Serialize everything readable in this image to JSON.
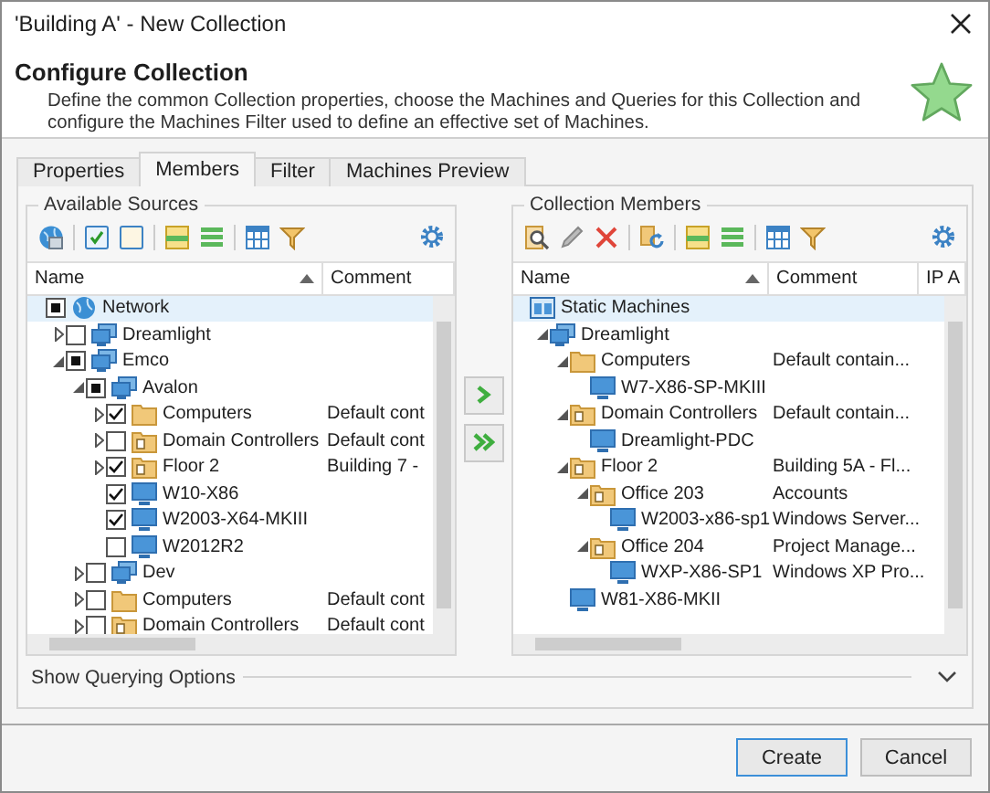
{
  "window": {
    "title": "'Building A' - New Collection"
  },
  "header": {
    "title": "Configure Collection",
    "description": "Define the common Collection properties, choose the Machines and Queries for this Collection and configure the Machines Filter used to define an effective set of Machines."
  },
  "tabs": [
    {
      "label": "Properties",
      "selected": false
    },
    {
      "label": "Members",
      "selected": true
    },
    {
      "label": "Filter",
      "selected": false
    },
    {
      "label": "Machines Preview",
      "selected": false
    }
  ],
  "sources": {
    "title": "Available Sources",
    "columns": [
      "Name",
      "Comment"
    ],
    "tree": [
      {
        "name": "Network",
        "kind": "network",
        "checked": true,
        "partial": true,
        "selected": true,
        "children": [
          {
            "name": "Dreamlight",
            "kind": "group",
            "checked": false,
            "partial": false,
            "expanded": false,
            "selected": false
          },
          {
            "name": "Emco",
            "kind": "group",
            "checked": true,
            "partial": true,
            "expanded": true,
            "selected": false,
            "children": [
              {
                "name": "Avalon",
                "kind": "group",
                "checked": true,
                "partial": true,
                "expanded": true,
                "selected": false,
                "children": [
                  {
                    "name": "Computers",
                    "kind": "folder",
                    "checked": true,
                    "partial": false,
                    "expanded": false,
                    "selected": false,
                    "comment": "Default cont"
                  },
                  {
                    "name": "Domain Controllers",
                    "kind": "ou",
                    "checked": false,
                    "partial": false,
                    "expanded": false,
                    "selected": false,
                    "comment": "Default cont"
                  },
                  {
                    "name": "Floor 2",
                    "kind": "ou",
                    "checked": true,
                    "partial": false,
                    "expanded": false,
                    "selected": false,
                    "comment": "Building 7 -"
                  },
                  {
                    "name": "W10-X86",
                    "kind": "computer",
                    "checked": true,
                    "partial": false,
                    "selected": false
                  },
                  {
                    "name": "W2003-X64-MKIII",
                    "kind": "computer",
                    "checked": true,
                    "partial": false,
                    "selected": false
                  },
                  {
                    "name": "W2012R2",
                    "kind": "computer",
                    "checked": false,
                    "partial": false,
                    "selected": false
                  }
                ]
              },
              {
                "name": "Dev",
                "kind": "group",
                "checked": false,
                "partial": false,
                "expanded": false,
                "selected": false
              },
              {
                "name": "Computers",
                "kind": "folder",
                "checked": false,
                "partial": false,
                "expanded": false,
                "selected": false,
                "comment": "Default cont"
              },
              {
                "name": "Domain Controllers",
                "kind": "ou",
                "checked": false,
                "partial": false,
                "expanded": false,
                "selected": false,
                "comment": "Default cont"
              }
            ]
          }
        ]
      }
    ]
  },
  "members": {
    "title": "Collection Members",
    "columns": [
      "Name",
      "Comment",
      "IP A"
    ],
    "tree": [
      {
        "name": "Static Machines",
        "kind": "static",
        "selected": true,
        "children": [
          {
            "name": "Dreamlight",
            "kind": "group",
            "expanded": true,
            "selected": false,
            "children": [
              {
                "name": "Computers",
                "kind": "folder",
                "expanded": true,
                "selected": false,
                "comment": "Default contain...",
                "children": [
                  {
                    "name": "W7-X86-SP-MKIII",
                    "kind": "computer",
                    "selected": false
                  }
                ]
              },
              {
                "name": "Domain Controllers",
                "kind": "ou",
                "expanded": true,
                "selected": false,
                "comment": "Default contain...",
                "children": [
                  {
                    "name": "Dreamlight-PDC",
                    "kind": "computer",
                    "selected": false
                  }
                ]
              },
              {
                "name": "Floor 2",
                "kind": "ou",
                "expanded": true,
                "selected": false,
                "comment": "Building 5A - Fl...",
                "children": [
                  {
                    "name": "Office 203",
                    "kind": "ou",
                    "expanded": true,
                    "selected": false,
                    "comment": "Accounts",
                    "children": [
                      {
                        "name": "W2003-x86-sp1",
                        "kind": "computer",
                        "selected": false,
                        "comment": "Windows Server..."
                      }
                    ]
                  },
                  {
                    "name": "Office 204",
                    "kind": "ou",
                    "expanded": true,
                    "selected": false,
                    "comment": "Project Manage...",
                    "children": [
                      {
                        "name": "WXP-X86-SP1",
                        "kind": "computer",
                        "selected": false,
                        "comment": "Windows XP Pro..."
                      }
                    ]
                  }
                ]
              },
              {
                "name": "W81-X86-MKII",
                "kind": "computer",
                "selected": false
              }
            ]
          }
        ]
      }
    ]
  },
  "querying_options": {
    "label": "Show Querying Options",
    "expanded": false
  },
  "buttons": [
    {
      "label": "Create",
      "default": true
    },
    {
      "label": "Cancel",
      "default": false
    }
  ]
}
